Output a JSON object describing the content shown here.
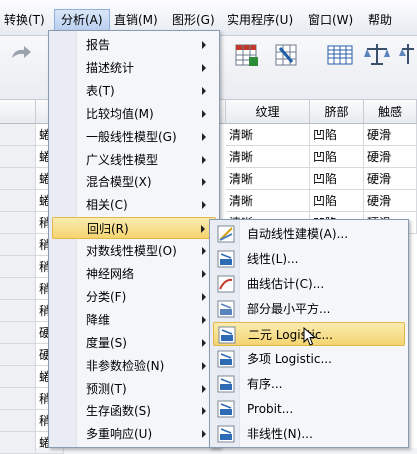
{
  "menubar": {
    "items": [
      "转换(T)",
      "分析(A)",
      "直销(M)",
      "图形(G)",
      "实用程序(U)",
      "窗口(W)",
      "帮助"
    ]
  },
  "grid": {
    "headers": [
      "纹理",
      "脐部",
      "触感"
    ],
    "rows": [
      [
        "清晰",
        "凹陷",
        "硬滑"
      ],
      [
        "清晰",
        "凹陷",
        "硬滑"
      ],
      [
        "清晰",
        "凹陷",
        "硬滑"
      ],
      [
        "清晰",
        "凹陷",
        "硬滑"
      ],
      [
        "清晰",
        "凹陷",
        "硬滑"
      ]
    ],
    "left_column": [
      "蜷",
      "蜷",
      "蜷",
      "蜷",
      "稍",
      "稍",
      "稍",
      "稍",
      "稍",
      "硬",
      "硬",
      "蜷",
      "稍",
      "稍",
      "蜷"
    ]
  },
  "analyze_menu": {
    "items": [
      "报告",
      "描述统计",
      "表(T)",
      "比较均值(M)",
      "一般线性模型(G)",
      "广义线性模型",
      "混合模型(X)",
      "相关(C)",
      "回归(R)",
      "对数线性模型(O)",
      "神经网络",
      "分类(F)",
      "降维",
      "度量(S)",
      "非参数检验(N)",
      "预测(T)",
      "生存函数(S)",
      "多重响应(U)"
    ],
    "highlighted": "回归(R)"
  },
  "regression_menu": {
    "items": [
      "自动线性建模(A)...",
      "线性(L)...",
      "曲线估计(C)...",
      "部分最小平方...",
      "二元 Logistic...",
      "多项 Logistic...",
      "有序...",
      "Probit...",
      "非线性(N)..."
    ],
    "highlighted": "二元 Logistic..."
  },
  "colors": {
    "highlight": "#f4d470",
    "accent": "#3a6ea5"
  }
}
